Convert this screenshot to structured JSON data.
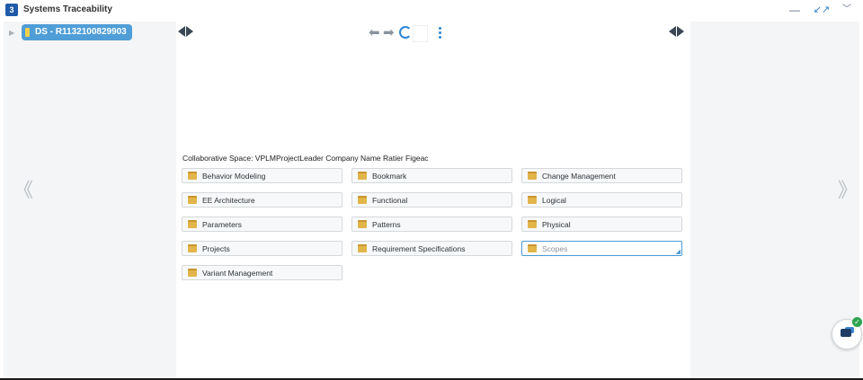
{
  "app": {
    "title": "Systems Traceability"
  },
  "tree": {
    "root_label": "DS - R1132100829903"
  },
  "content": {
    "collaborative_space": "Collaborative Space: VPLMProjectLeader Company Name Ratier Figeac",
    "folders": [
      {
        "label": "Behavior Modeling"
      },
      {
        "label": "Bookmark"
      },
      {
        "label": "Change Management"
      },
      {
        "label": "EE Architecture"
      },
      {
        "label": "Functional"
      },
      {
        "label": "Logical"
      },
      {
        "label": "Parameters"
      },
      {
        "label": "Patterns"
      },
      {
        "label": "Physical"
      },
      {
        "label": "Projects"
      },
      {
        "label": "Requirement Specifications"
      },
      {
        "label": "Scopes",
        "selected": true
      },
      {
        "label": "Variant Management"
      }
    ]
  },
  "colors": {
    "accent": "#4f9ed8",
    "selection_border": "#4a9ad6",
    "panel_bg": "#f4f5f6"
  },
  "icons": {
    "app_logo": "3ds-logo-icon",
    "minimize": "minimize-icon",
    "collapse": "collapse-icon",
    "menu": "chevron-down-icon",
    "nav_back": "arrow-left-icon",
    "nav_forward": "arrow-right-icon",
    "refresh": "refresh-icon",
    "more": "more-vertical-icon",
    "folder": "folder-icon",
    "chat": "chat-icon"
  }
}
